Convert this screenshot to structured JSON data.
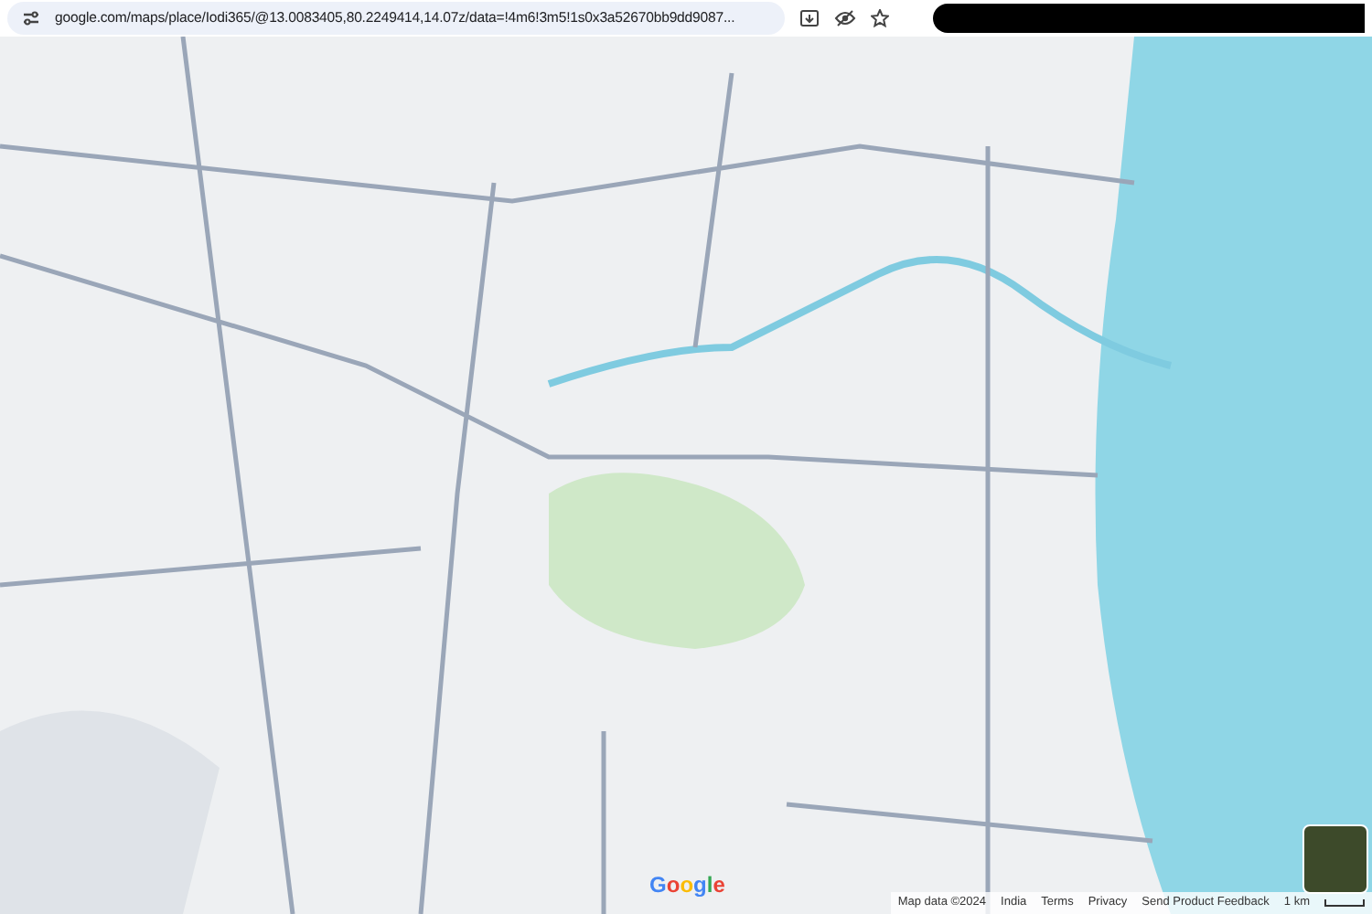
{
  "address_bar": {
    "url": "google.com/maps/place/Iodi365/@13.0083405,80.2249414,14.07z/data=!4m6!3m5!1s0x3a52670bb9dd9087..."
  },
  "map": {
    "logo": "Google",
    "footer": [
      "Map data ©2024",
      "India",
      "Terms",
      "Privacy",
      "Send Product Feedback"
    ],
    "scale": "1 km"
  }
}
